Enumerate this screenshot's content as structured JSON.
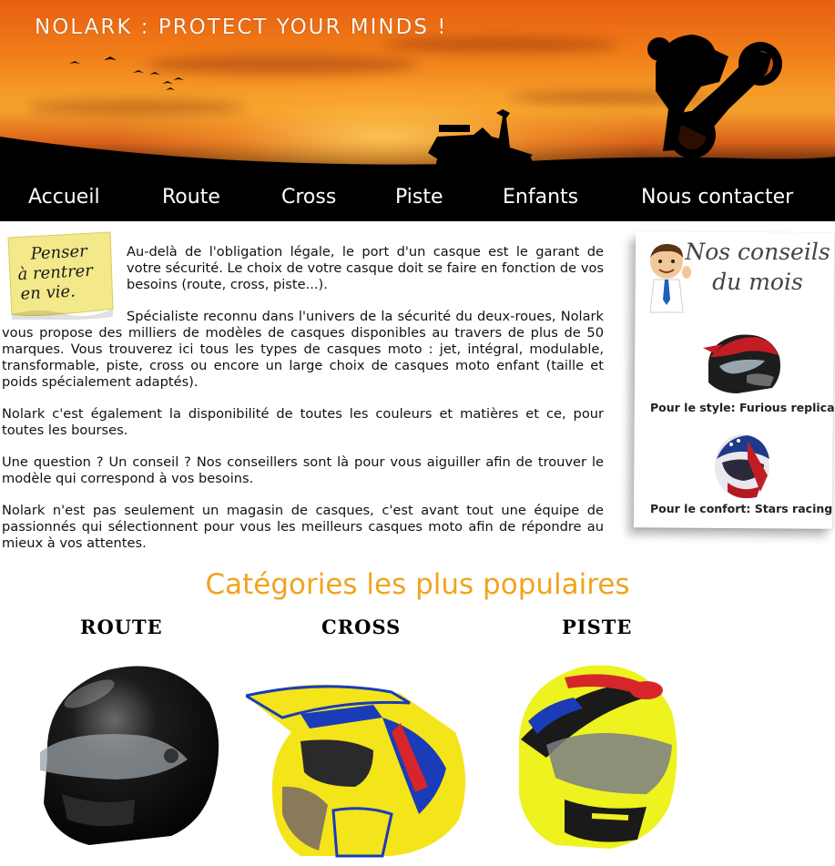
{
  "header": {
    "site_title": "Nolark : Protect your minds !"
  },
  "nav": {
    "items": [
      {
        "label": "Accueil"
      },
      {
        "label": "Route"
      },
      {
        "label": "Cross"
      },
      {
        "label": "Piste"
      },
      {
        "label": "Enfants"
      },
      {
        "label": "Nous contacter"
      }
    ]
  },
  "postit": {
    "lines": [
      "Penser",
      "à rentrer",
      "en vie."
    ]
  },
  "main": {
    "paragraphs": [
      "Au-delà de l'obligation légale, le port d'un casque est le garant de votre sécurité. Le choix de votre casque doit se faire en fonction de vos besoins (route, cross, piste...).",
      "Spécialiste reconnu dans l'univers de la sécurité du deux-roues, Nolark vous propose des milliers de modèles de casques disponibles au travers de plus de 50 marques. Vous trouverez ici tous les types de casques moto : jet, intégral, modulable, transformable, piste, cross ou encore un large choix de casques moto enfant (taille et poids spécialement adaptés).",
      "Nolark c'est également la disponibilité de toutes les couleurs et matières et ce, pour toutes les bourses.",
      "Une question ? Un conseil ? Nos conseillers sont là pour vous aiguiller afin de trouver le modèle qui correspond à vos besoins.",
      "Nolark n'est pas seulement un magasin de casques, c'est avant tout une équipe de passionnés qui sélectionnent pour vous les meilleurs casques moto afin de répondre au mieux à vos attentes."
    ]
  },
  "advice": {
    "title_line1": "Nos conseils",
    "title_line2": "du mois",
    "items": [
      {
        "caption": "Pour le style: Furious replica"
      },
      {
        "caption": "Pour le confort: Stars racing"
      }
    ]
  },
  "categories": {
    "heading": "Catégories les plus populaires",
    "items": [
      {
        "label": "Route"
      },
      {
        "label": "Cross"
      },
      {
        "label": "Piste"
      }
    ]
  },
  "colors": {
    "accent": "#f0a41e",
    "nav_bg": "#000000",
    "nav_text": "#ffffff"
  }
}
